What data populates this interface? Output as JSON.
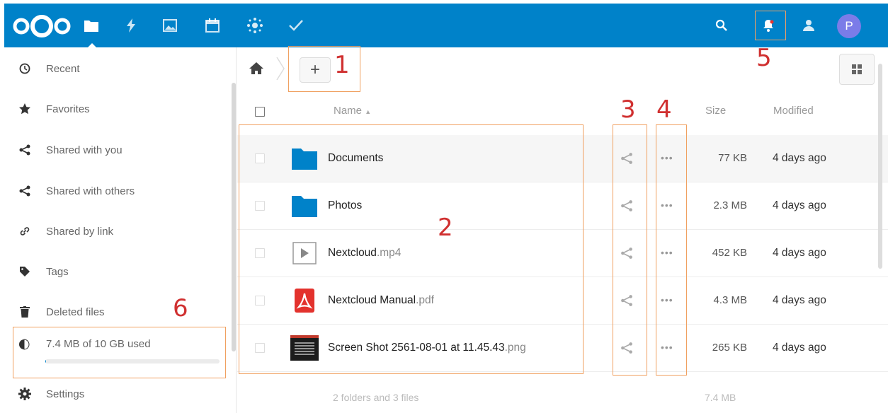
{
  "header": {
    "avatar_letter": "P",
    "bg_color": "#0082c9",
    "apps": [
      "files-icon",
      "activity-icon",
      "gallery-icon",
      "calendar-icon",
      "circles-icon",
      "tasks-icon"
    ],
    "right_icons": [
      "search-icon",
      "notifications-icon",
      "contacts-icon"
    ]
  },
  "sidebar": {
    "items": [
      {
        "label": "Recent",
        "icon": "clock-icon"
      },
      {
        "label": "Favorites",
        "icon": "star-icon"
      },
      {
        "label": "Shared with you",
        "icon": "share-icon"
      },
      {
        "label": "Shared with others",
        "icon": "share-icon"
      },
      {
        "label": "Shared by link",
        "icon": "link-icon"
      },
      {
        "label": "Tags",
        "icon": "tag-icon"
      },
      {
        "label": "Deleted files",
        "icon": "trash-icon"
      }
    ],
    "quota": {
      "label": "7.4 MB of 10 GB used",
      "used_fraction": 0.0007
    },
    "settings_label": "Settings"
  },
  "toolbar": {
    "new_label": "+"
  },
  "table": {
    "headers": {
      "name": "Name",
      "size": "Size",
      "modified": "Modified"
    },
    "rows": [
      {
        "base": "Documents",
        "ext": "",
        "type": "folder",
        "size": "77 KB",
        "modified": "4 days ago"
      },
      {
        "base": "Photos",
        "ext": "",
        "type": "folder",
        "size": "2.3 MB",
        "modified": "4 days ago"
      },
      {
        "base": "Nextcloud",
        "ext": ".mp4",
        "type": "video",
        "size": "452 KB",
        "modified": "4 days ago"
      },
      {
        "base": "Nextcloud Manual",
        "ext": ".pdf",
        "type": "pdf",
        "size": "4.3 MB",
        "modified": "4 days ago"
      },
      {
        "base": "Screen Shot 2561-08-01 at 11.45.43",
        "ext": ".png",
        "type": "image",
        "size": "265 KB",
        "modified": "4 days ago"
      }
    ],
    "more_label": "•••",
    "summary": {
      "text": "2 folders and 3 files",
      "total": "7.4 MB"
    }
  },
  "annotations": [
    "1",
    "2",
    "3",
    "4",
    "5",
    "6"
  ]
}
